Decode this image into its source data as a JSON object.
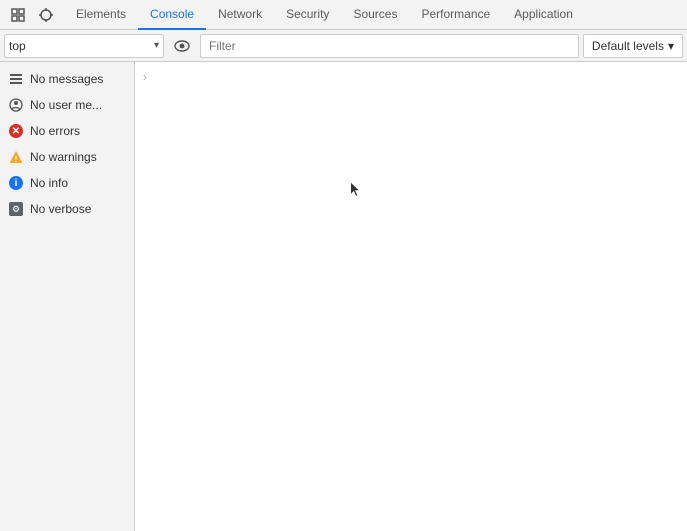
{
  "tabs": {
    "items": [
      {
        "label": "Elements",
        "active": false
      },
      {
        "label": "Console",
        "active": true
      },
      {
        "label": "Network",
        "active": false
      },
      {
        "label": "Security",
        "active": false
      },
      {
        "label": "Sources",
        "active": false
      },
      {
        "label": "Performance",
        "active": false
      },
      {
        "label": "Application",
        "active": false
      }
    ]
  },
  "toolbar": {
    "context_value": "top",
    "filter_placeholder": "Filter",
    "levels_label": "Default levels",
    "levels_arrow": "▾"
  },
  "sidebar": {
    "items": [
      {
        "id": "messages",
        "label": "No messages",
        "icon_type": "list"
      },
      {
        "id": "user-messages",
        "label": "No user me...",
        "icon_type": "user"
      },
      {
        "id": "errors",
        "label": "No errors",
        "icon_type": "error"
      },
      {
        "id": "warnings",
        "label": "No warnings",
        "icon_type": "warning"
      },
      {
        "id": "info",
        "label": "No info",
        "icon_type": "info"
      },
      {
        "id": "verbose",
        "label": "No verbose",
        "icon_type": "verbose"
      }
    ]
  },
  "icons": {
    "devtools_icon": "⚙",
    "inspect_icon": "⬚",
    "chevron_right": "›",
    "eye_symbol": "👁",
    "select_arrow": "▾"
  }
}
